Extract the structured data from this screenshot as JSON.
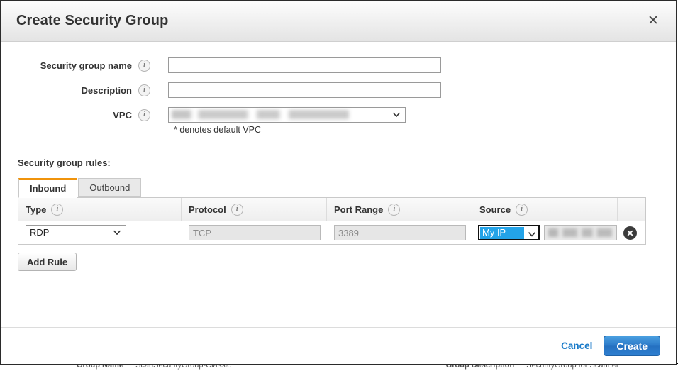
{
  "modal": {
    "title": "Create Security Group",
    "close_icon": "close-icon",
    "form": {
      "security_group_name": {
        "label": "Security group name",
        "info_icon": "info-icon",
        "value": "",
        "placeholder": ""
      },
      "description": {
        "label": "Description",
        "info_icon": "info-icon",
        "value": "",
        "placeholder": ""
      },
      "vpc": {
        "label": "VPC",
        "info_icon": "info-icon",
        "value": "",
        "redacted": true,
        "caret_icon": "chevron-down-icon"
      },
      "helper_text": "* denotes default VPC"
    },
    "rules_section": {
      "title": "Security group rules:",
      "tabs": [
        {
          "label": "Inbound",
          "active": true
        },
        {
          "label": "Outbound",
          "active": false
        }
      ],
      "columns": [
        {
          "label": "Type",
          "info_icon": "info-icon"
        },
        {
          "label": "Protocol",
          "info_icon": "info-icon"
        },
        {
          "label": "Port Range",
          "info_icon": "info-icon"
        },
        {
          "label": "Source",
          "info_icon": "info-icon"
        }
      ],
      "rows": [
        {
          "type": "RDP",
          "protocol": "TCP",
          "protocol_disabled": true,
          "port_range": "3389",
          "port_disabled": true,
          "source": "My IP",
          "source_focused": true,
          "source_value": "",
          "source_value_redacted": true,
          "remove_icon": "remove-circle-icon"
        }
      ],
      "add_rule_label": "Add Rule"
    },
    "footer": {
      "cancel_label": "Cancel",
      "create_label": "Create"
    }
  },
  "background": {
    "col1_label": "Group Name",
    "col1_value": "ScanSecurityGroup-Classic",
    "col2_label": "Group Description",
    "col2_value": "SecurityGroup for Scanner"
  },
  "colors": {
    "tab_accent": "#f0930b",
    "primary_button": "#2a78c8",
    "link": "#1a7bc9",
    "select_highlight": "#23a3e8"
  }
}
